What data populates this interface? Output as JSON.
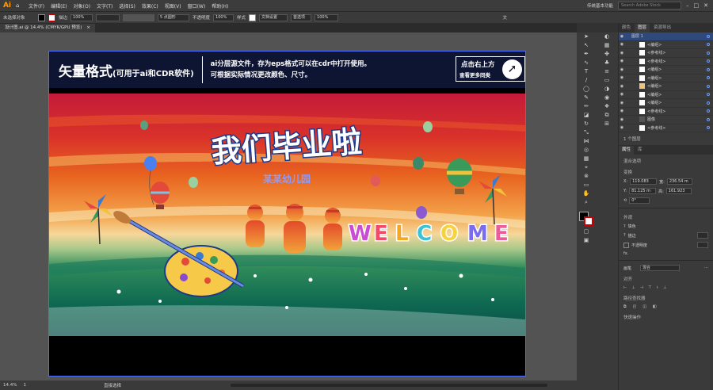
{
  "app": {
    "logo": "Ai",
    "workspace": "传统基本功能",
    "search_placeholder": "Search Adobe Stock"
  },
  "menus": [
    "文件(F)",
    "编辑(E)",
    "对象(O)",
    "文字(T)",
    "选择(S)",
    "效果(C)",
    "视图(V)",
    "窗口(W)",
    "帮助(H)"
  ],
  "control": {
    "selection": "未选择对象",
    "stroke_label": "描边",
    "opacity_pct": "100%",
    "point_label": "5 点圆形",
    "opacity_label": "不透明度",
    "opacity_val": "100%",
    "style_label": "样式",
    "doc_setup": "文档设置",
    "prefs": "首选项",
    "view_pct": "100%",
    "type_label": "文"
  },
  "doc_tab": {
    "name": "设计图.ai @ 14.4% (CMYK/GPU 预览)",
    "close": "×"
  },
  "banner": {
    "title": "矢量格式",
    "title_sub": "(可用于ai和CDR软件)",
    "desc1": "ai分层源文件，存为eps格式可以在cdr中打开使用。",
    "desc2": "可根据实际情况更改颜色、尺寸。",
    "cta1": "点击右上方",
    "cta2": "查看更多同类",
    "cta_icon": "arrow-up-right-icon"
  },
  "art": {
    "headline": "我们毕业啦",
    "kindergarten": "某某幼儿园",
    "welcome_letters": [
      "W",
      "E",
      "L",
      "C",
      "O",
      "M",
      "E"
    ],
    "welcome_colors": [
      "#c94bd6",
      "#f24a6a",
      "#f5a623",
      "#3ec1d3",
      "#f5d23e",
      "#7a6cf0",
      "#e85d9b"
    ]
  },
  "status": {
    "zoom": "14.4%",
    "page": "1",
    "tool": "直接选择"
  },
  "panel": {
    "tabs": [
      "颜色",
      "图层",
      "资源导出"
    ],
    "layer_group": "图层 1",
    "layers": [
      "<编组>",
      "<参考线>",
      "<参考线>",
      "<编组>",
      "<编组>",
      "<编组>",
      "<编组>",
      "<编组>",
      "<参考线>",
      "图像",
      "<参考线>"
    ],
    "layer_count": "1 个图层",
    "props_tabs": [
      "属性",
      "库"
    ],
    "no_selection": "混合选项",
    "transform": "变换",
    "x": "119.083",
    "y": "81.125 m",
    "w": "236.54 m",
    "h": "161.923",
    "angle": "0°",
    "appearance": "外观",
    "fill": "填色",
    "stroke": "描边",
    "opacity": "不透明度",
    "fx": "fx.",
    "blend_label": "画笔",
    "blend": "混合",
    "align": "对齐",
    "pathfinder": "路径查找器",
    "quick_actions": "快速操作"
  }
}
